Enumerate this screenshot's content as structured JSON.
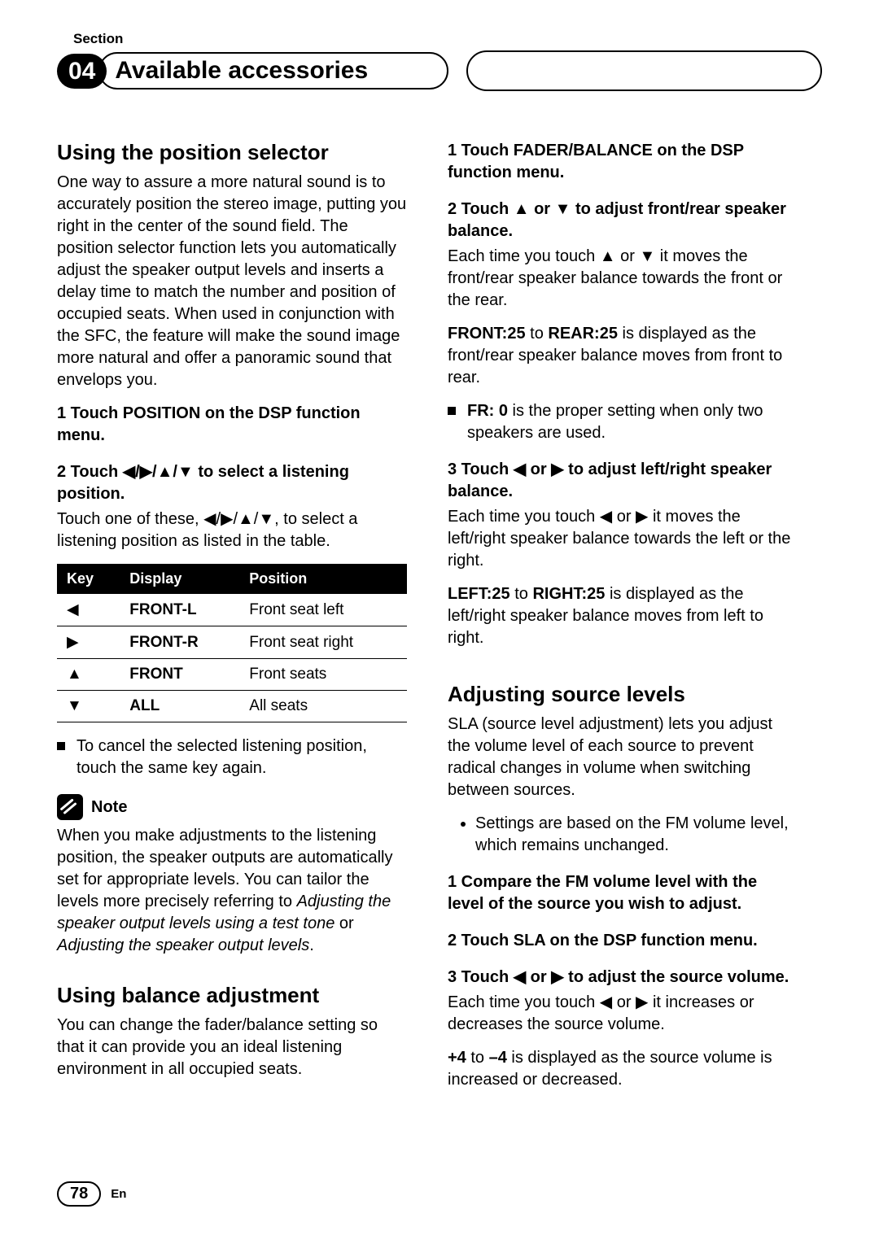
{
  "header": {
    "section_label": "Section",
    "chapter": "04",
    "title": "Available accessories"
  },
  "left": {
    "h_position": "Using the position selector",
    "p_position": "One way to assure a more natural sound is to accurately position the stereo image, putting you right in the center of the sound field. The position selector function lets you automatically adjust the speaker output levels and inserts a delay time to match the number and position of occupied seats. When used in conjunction with the SFC, the feature will make the sound image more natural and offer a panoramic sound that envelops you.",
    "step1": "1    Touch POSITION on the DSP function menu.",
    "step2": "2    Touch ◀/▶/▲/▼ to select a listening position.",
    "step2_body": "Touch one of these, ◀/▶/▲/▼, to select a listening position as listed in the table.",
    "table": {
      "head": [
        "Key",
        "Display",
        "Position"
      ],
      "rows": [
        {
          "key": "◀",
          "display": "FRONT-L",
          "position": "Front seat left"
        },
        {
          "key": "▶",
          "display": "FRONT-R",
          "position": "Front seat right"
        },
        {
          "key": "▲",
          "display": "FRONT",
          "position": "Front seats"
        },
        {
          "key": "▼",
          "display": "ALL",
          "position": "All seats"
        }
      ]
    },
    "cancel": "To cancel the selected listening position, touch the same key again.",
    "note_label": "Note",
    "note_body_a": "When you make adjustments to the listening position, the speaker outputs are automatically set for appropriate levels. You can tailor the levels more precisely referring to ",
    "note_body_i1": "Adjusting the speaker output levels using a test tone",
    "note_body_mid": " or ",
    "note_body_i2": "Adjusting the speaker output levels",
    "note_body_end": ".",
    "h_balance": "Using balance adjustment",
    "p_balance": "You can change the fader/balance setting so that it can provide you an ideal listening environment in all occupied seats."
  },
  "right": {
    "step1": "1    Touch FADER/BALANCE on the DSP function menu.",
    "step2": "2    Touch ▲ or ▼ to adjust front/rear speaker balance.",
    "step2_body": "Each time you touch ▲ or ▼ it moves the front/rear speaker balance towards the front or the rear.",
    "step2_rangeA": "FRONT:25",
    "step2_rangeMid": " to ",
    "step2_rangeB": "REAR:25",
    "step2_rangeTail": " is displayed as the front/rear speaker balance moves from front to rear.",
    "fr0_label": "FR: 0",
    "fr0_tail": " is the proper setting when only two speakers are used.",
    "step3": "3    Touch ◀ or ▶ to adjust left/right speaker balance.",
    "step3_body": "Each time you touch ◀ or ▶ it moves the left/right speaker balance towards the left or the right.",
    "step3_rangeA": "LEFT:25",
    "step3_rangeMid": " to ",
    "step3_rangeB": "RIGHT:25",
    "step3_rangeTail": " is displayed as the left/right speaker balance moves from left to right.",
    "h_sla": "Adjusting source levels",
    "p_sla": "SLA (source level adjustment) lets you adjust the volume level of each source to prevent radical changes in volume when switching between sources.",
    "sla_bullet": "Settings are based on the FM volume level, which remains unchanged.",
    "sla_step1": "1    Compare the FM volume level with the level of the source you wish to adjust.",
    "sla_step2": "2    Touch SLA on the DSP function menu.",
    "sla_step3": "3    Touch ◀ or ▶ to adjust the source volume.",
    "sla_step3_body": "Each time you touch ◀ or ▶ it increases or decreases the source volume.",
    "sla_rangeA": "+4",
    "sla_rangeMid": " to ",
    "sla_rangeB": "–4",
    "sla_rangeTail": " is displayed as the source volume is increased or decreased."
  },
  "footer": {
    "page": "78",
    "lang": "En"
  }
}
